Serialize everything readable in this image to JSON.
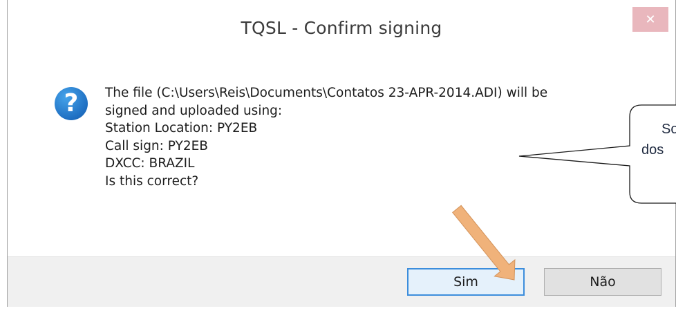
{
  "dialog": {
    "title": "TQSL - Confirm signing",
    "close_glyph": "✕",
    "icon": "question-icon",
    "message_lines": [
      "The file (C:\\Users\\Reis\\Documents\\Contatos 23-APR-2014.ADI) will be",
      "signed and uploaded using:",
      "Station Location: PY2EB",
      "Call sign: PY2EB",
      "DXCC: BRAZIL",
      "Is this correct?"
    ],
    "yes_label": "Sim",
    "no_label": "Não"
  },
  "callout": {
    "line1": "So",
    "line2": "dos"
  },
  "colors": {
    "accent": "#3c8ddc",
    "close_button": "#e9b7bd",
    "arrow": "#f0b27a"
  }
}
